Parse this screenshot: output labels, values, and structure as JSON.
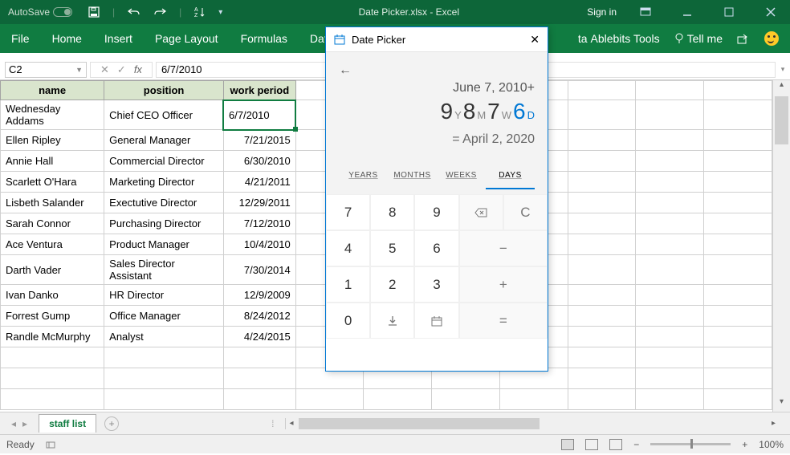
{
  "title": "Date Picker.xlsx - Excel",
  "titlebar": {
    "autosave": "AutoSave",
    "autosave_state": "Off",
    "signin": "Sign in"
  },
  "ribbon": {
    "tabs": [
      "File",
      "Home",
      "Insert",
      "Page Layout",
      "Formulas",
      "Data"
    ],
    "tabs_r": "ta",
    "ablebits": "Ablebits Tools",
    "tellme": "Tell me"
  },
  "fbar": {
    "cell": "C2",
    "value": "6/7/2010"
  },
  "headers": [
    "name",
    "position",
    "work period"
  ],
  "rows": [
    {
      "name": "Wednesday Addams",
      "pos": "Chief CEO Officer",
      "date": "6/7/2010"
    },
    {
      "name": "Ellen Ripley",
      "pos": "General Manager",
      "date": "7/21/2015"
    },
    {
      "name": "Annie Hall",
      "pos": "Commercial Director",
      "date": "6/30/2010"
    },
    {
      "name": "Scarlett O'Hara",
      "pos": "Marketing Director",
      "date": "4/21/2011"
    },
    {
      "name": "Lisbeth Salander",
      "pos": "Exectutive Director",
      "date": "12/29/2011"
    },
    {
      "name": "Sarah Connor",
      "pos": "Purchasing Director",
      "date": "7/12/2010"
    },
    {
      "name": "Ace Ventura",
      "pos": "Product Manager",
      "date": "10/4/2010"
    },
    {
      "name": "Darth Vader",
      "pos": "Sales Director Assistant",
      "date": "7/30/2014"
    },
    {
      "name": "Ivan Danko",
      "pos": "HR Director",
      "date": "12/9/2009"
    },
    {
      "name": "Forrest Gump",
      "pos": "Office Manager",
      "date": "8/24/2012"
    },
    {
      "name": "Randle McMurphy",
      "pos": "Analyst",
      "date": "4/24/2015"
    }
  ],
  "sheet_tab": "staff list",
  "status": {
    "ready": "Ready",
    "zoom": "100%"
  },
  "panel": {
    "title": "Date Picker",
    "base_date": "June 7, 2010+",
    "offset": {
      "y": "9",
      "yl": "Y",
      "m": "8",
      "ml": "M",
      "w": "7",
      "wl": "W",
      "d": "6",
      "dl": "D"
    },
    "result": "= April 2, 2020",
    "units": [
      "YEARS",
      "MONTHS",
      "WEEKS",
      "DAYS"
    ],
    "keys": [
      [
        "7",
        "8",
        "9",
        "bksp",
        "C"
      ],
      [
        "4",
        "5",
        "6",
        "minus",
        ""
      ],
      [
        "1",
        "2",
        "3",
        "plus",
        ""
      ],
      [
        "0",
        "download",
        "cal",
        "equals",
        ""
      ]
    ]
  }
}
